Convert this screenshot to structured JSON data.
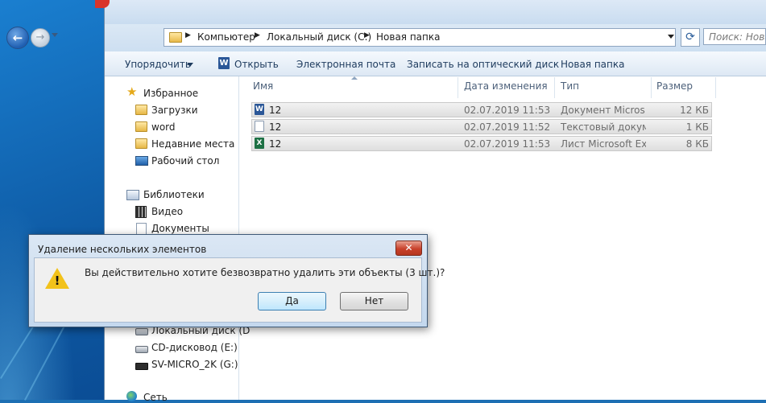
{
  "explorer": {
    "address": {
      "segments": [
        "Компьютер",
        "Локальный диск (C:)",
        "Новая папка"
      ]
    },
    "search_placeholder": "Поиск: Новая",
    "toolbar": {
      "organize": "Упорядочить",
      "open": "Открыть",
      "email": "Электронная почта",
      "burn": "Записать на оптический диск",
      "new_folder": "Новая папка"
    },
    "nav": {
      "favorites": "Избранное",
      "downloads": "Загрузки",
      "word": "word",
      "recent": "Недавние места",
      "desktop": "Рабочий стол",
      "libraries": "Библиотеки",
      "video": "Видео",
      "documents": "Документы",
      "local_disk": "Локальный диск (D",
      "cd_drive": "CD-дисковод (E:)",
      "usb": "SV-MICRO_2K (G:)",
      "network": "Сеть"
    },
    "columns": {
      "name": "Имя",
      "date": "Дата изменения",
      "type": "Тип",
      "size": "Размер"
    },
    "files": [
      {
        "name": "12",
        "date": "02.07.2019 11:53",
        "type": "Документ Micros...",
        "size": "12 КБ",
        "icon": "word-doc-icon"
      },
      {
        "name": "12",
        "date": "02.07.2019 11:52",
        "type": "Текстовый докум...",
        "size": "1 КБ",
        "icon": "text-doc-icon"
      },
      {
        "name": "12",
        "date": "02.07.2019 11:53",
        "type": "Лист Microsoft Ex...",
        "size": "8 КБ",
        "icon": "excel-sheet-icon"
      }
    ]
  },
  "dialog": {
    "title": "Удаление нескольких элементов",
    "message": "Вы действительно хотите безвозвратно удалить эти объекты (3 шт.)?",
    "yes": "Да",
    "no": "Нет",
    "close_glyph": "✕",
    "warning_glyph": "!"
  },
  "colors": {
    "desktop": "#1d6fb3",
    "dialog_close": "#c8412b",
    "warning": "#f2c21b"
  }
}
